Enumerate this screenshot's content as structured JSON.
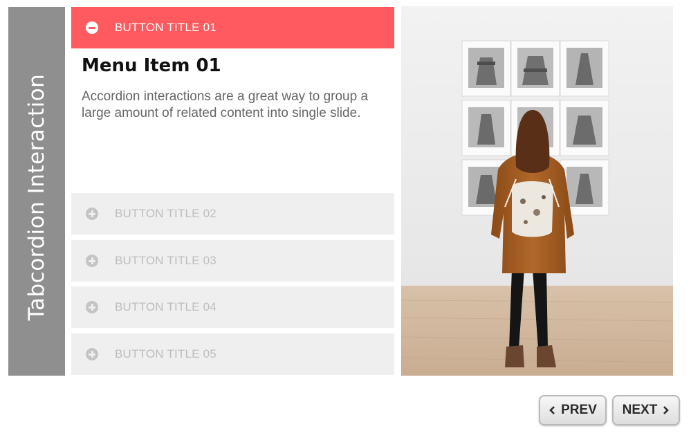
{
  "side_tab": {
    "title": "Tabcordion Interaction"
  },
  "accordion": {
    "active": {
      "label": "BUTTON TITLE 01",
      "heading": "Menu Item 01",
      "body": "Accordion interactions are a great way to group a large amount of related content into single slide."
    },
    "collapsed": [
      {
        "label": "BUTTON TITLE 02"
      },
      {
        "label": "BUTTON TITLE 03"
      },
      {
        "label": "BUTTON TITLE 04"
      },
      {
        "label": "BUTTON TITLE 05"
      }
    ]
  },
  "photo": {
    "icon": "gallery-photo"
  },
  "nav": {
    "prev_label": "PREV",
    "next_label": "NEXT"
  },
  "colors": {
    "accent": "#ff5a5f",
    "side_tab": "#8f8f8f",
    "collapsed_bg": "#efefef"
  }
}
